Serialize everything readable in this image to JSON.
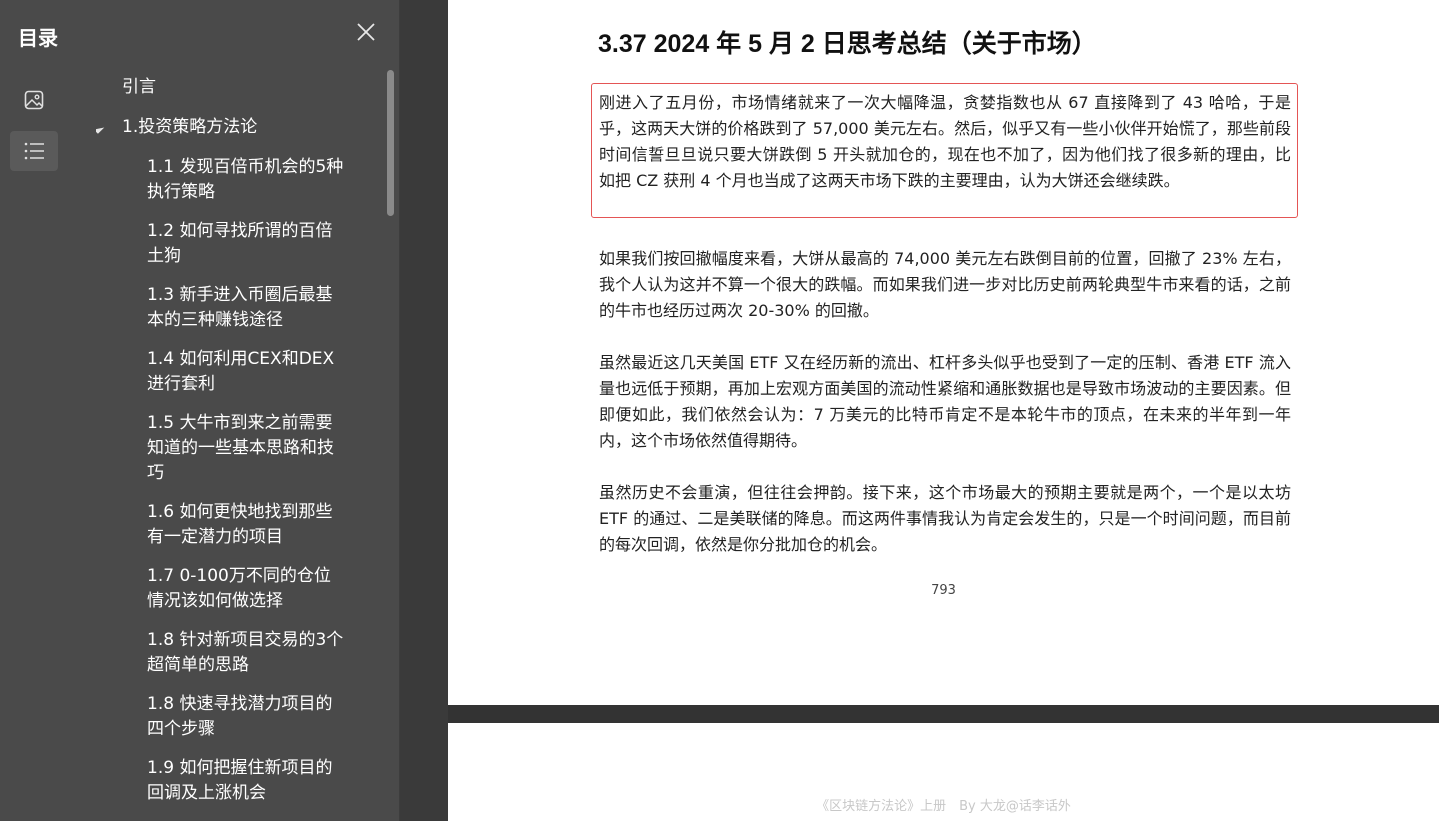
{
  "sidebar": {
    "title": "目录",
    "close_icon": "close-icon",
    "rail": [
      {
        "name": "image-icon"
      },
      {
        "name": "list-icon",
        "active": true
      }
    ],
    "toc": [
      {
        "level": 0,
        "label": "引言",
        "expandable": false
      },
      {
        "level": 0,
        "label": "1.投资策略方法论",
        "expandable": true,
        "expanded": true
      },
      {
        "level": 1,
        "label": "1.1 发现百倍币机会的5种执行策略"
      },
      {
        "level": 1,
        "label": "1.2 如何寻找所谓的百倍土狗"
      },
      {
        "level": 1,
        "label": "1.3 新手进入币圈后最基本的三种赚钱途径"
      },
      {
        "level": 1,
        "label": "1.4 如何利用CEX和DEX进行套利"
      },
      {
        "level": 1,
        "label": "1.5 大牛市到来之前需要知道的一些基本思路和技巧"
      },
      {
        "level": 1,
        "label": "1.6 如何更快地找到那些有一定潜力的项目"
      },
      {
        "level": 1,
        "label": "1.7 0-100万不同的仓位情况该如何做选择"
      },
      {
        "level": 1,
        "label": "1.8 针对新项目交易的3个超简单的思路"
      },
      {
        "level": 1,
        "label": "1.8 快速寻找潜力项目的四个步骤"
      },
      {
        "level": 1,
        "label": "1.9 如何把握住新项目的回调及上涨机会"
      }
    ]
  },
  "document": {
    "heading": "3.37 2024 年 5 月 2 日思考总结（关于市场）",
    "paragraphs": [
      "刚进入了五月份，市场情绪就来了一次大幅降温，贪婪指数也从 67 直接降到了 43 哈哈，于是乎，这两天大饼的价格跌到了 57,000 美元左右。然后，似乎又有一些小伙伴开始慌了，那些前段时间信誓旦旦说只要大饼跌倒 5 开头就加仓的，现在也不加了，因为他们找了很多新的理由，比如把 CZ 获刑 4 个月也当成了这两天市场下跌的主要理由，认为大饼还会继续跌。",
      "如果我们按回撤幅度来看，大饼从最高的 74,000 美元左右跌倒目前的位置，回撤了 23% 左右，我个人认为这并不算一个很大的跌幅。而如果我们进一步对比历史前两轮典型牛市来看的话，之前的牛市也经历过两次 20-30% 的回撤。",
      "虽然最近这几天美国 ETF 又在经历新的流出、杠杆多头似乎也受到了一定的压制、香港 ETF 流入量也远低于预期，再加上宏观方面美国的流动性紧缩和通胀数据也是导致市场波动的主要因素。但即便如此，我们依然会认为：7 万美元的比特币肯定不是本轮牛市的顶点，在未来的半年到一年内，这个市场依然值得期待。",
      "虽然历史不会重演，但往往会押韵。接下来，这个市场最大的预期主要就是两个，一个是以太坊 ETF 的通过、二是美联储的降息。而这两件事情我认为肯定会发生的，只是一个时间问题，而目前的每次回调，依然是你分批加仓的机会。"
    ],
    "page_number": "793",
    "next_page_footer": "《区块链方法论》上册　By 大龙@话李话外",
    "highlight_color": "#e45555"
  }
}
